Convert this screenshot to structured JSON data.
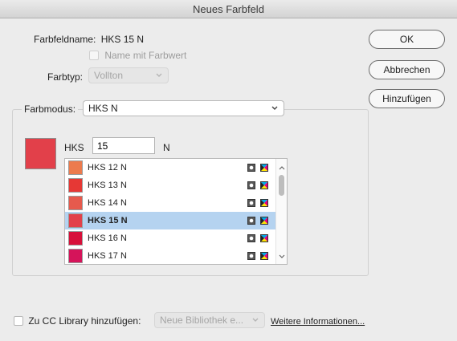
{
  "window": {
    "title": "Neues Farbfeld"
  },
  "swatch_name": {
    "label": "Farbfeldname:",
    "value": "HKS 15 N"
  },
  "name_with_value": {
    "label": "Name mit Farbwert",
    "checked": false,
    "enabled": false
  },
  "color_type": {
    "label": "Farbtyp:",
    "value": "Vollton",
    "enabled": false
  },
  "color_mode": {
    "label": "Farbmodus:",
    "value": "HKS N"
  },
  "hks": {
    "prefix_label": "HKS",
    "input_value": "15",
    "suffix_label": "N",
    "preview_color": "#e2404a"
  },
  "swatch_list": {
    "items": [
      {
        "label": "HKS 12 N",
        "color": "#ec7b4e"
      },
      {
        "label": "HKS 13 N",
        "color": "#e63835"
      },
      {
        "label": "HKS 14 N",
        "color": "#e65a4d"
      },
      {
        "label": "HKS 15 N",
        "color": "#e2404a",
        "selected": true
      },
      {
        "label": "HKS 16 N",
        "color": "#d7103a"
      },
      {
        "label": "HKS 17 N",
        "color": "#d5145a"
      }
    ],
    "icons": [
      "spot-color-icon",
      "process-color-icon"
    ]
  },
  "buttons": {
    "ok": "OK",
    "cancel": "Abbrechen",
    "add": "Hinzufügen"
  },
  "cc_library": {
    "checkbox_label": "Zu CC Library hinzufügen:",
    "library_value": "Neue Bibliothek e...",
    "more_info": "Weitere Informationen..."
  },
  "colors": {
    "selection": "#b5d3f0",
    "background": "#ececec"
  }
}
